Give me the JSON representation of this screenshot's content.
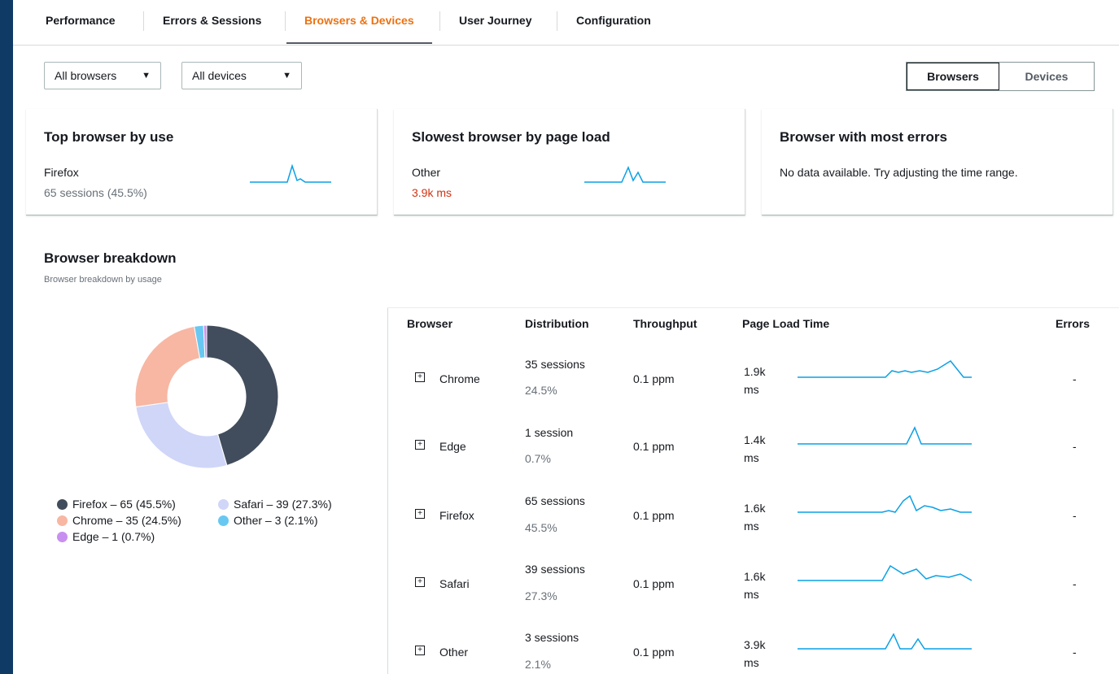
{
  "tabs": [
    "Performance",
    "Errors & Sessions",
    "Browsers & Devices",
    "User Journey",
    "Configuration"
  ],
  "active_tab_index": 2,
  "filters": {
    "browsers_select": "All browsers",
    "devices_select": "All devices"
  },
  "view_toggle": {
    "browsers": "Browsers",
    "devices": "Devices",
    "selected": "Browsers"
  },
  "cards": {
    "top_use": {
      "title": "Top browser by use",
      "name": "Firefox",
      "value": "65 sessions (45.5%)"
    },
    "slowest": {
      "title": "Slowest browser by page load",
      "name": "Other",
      "value": "3.9k ms"
    },
    "most_errors": {
      "title": "Browser with most errors",
      "message": "No data available. Try adjusting the time range."
    }
  },
  "breakdown": {
    "title": "Browser breakdown",
    "subtitle": "Browser breakdown by usage"
  },
  "chart_data": {
    "type": "pie",
    "slices": [
      {
        "label": "Firefox – 65 (45.5%)",
        "name": "Firefox",
        "value": 65,
        "color": "#414d5c"
      },
      {
        "label": "Safari – 39 (27.3%)",
        "name": "Safari",
        "value": 39,
        "color": "#cfd6f8"
      },
      {
        "label": "Chrome – 35 (24.5%)",
        "name": "Chrome",
        "value": 35,
        "color": "#f7b7a3"
      },
      {
        "label": "Other – 3 (2.1%)",
        "name": "Other",
        "value": 3,
        "color": "#68c8f2"
      },
      {
        "label": "Edge – 1 (0.7%)",
        "name": "Edge",
        "value": 1,
        "color": "#c790f0"
      }
    ]
  },
  "table": {
    "headers": [
      "Browser",
      "Distribution",
      "Throughput",
      "Page Load Time",
      "Errors"
    ],
    "rows": [
      {
        "browser": "Chrome",
        "sessions": "35 sessions",
        "pct": "24.5%",
        "throughput": "0.1 ppm",
        "load": "1.9k",
        "unit": "ms",
        "errors": "-"
      },
      {
        "browser": "Edge",
        "sessions": "1 session",
        "pct": "0.7%",
        "throughput": "0.1 ppm",
        "load": "1.4k",
        "unit": "ms",
        "errors": "-"
      },
      {
        "browser": "Firefox",
        "sessions": "65 sessions",
        "pct": "45.5%",
        "throughput": "0.1 ppm",
        "load": "1.6k",
        "unit": "ms",
        "errors": "-"
      },
      {
        "browser": "Safari",
        "sessions": "39 sessions",
        "pct": "27.3%",
        "throughput": "0.1 ppm",
        "load": "1.6k",
        "unit": "ms",
        "errors": "-"
      },
      {
        "browser": "Other",
        "sessions": "3 sessions",
        "pct": "2.1%",
        "throughput": "0.1 ppm",
        "load": "3.9k",
        "unit": "ms",
        "errors": "-"
      }
    ]
  },
  "colors": {
    "accent": "#ec7211",
    "sparkline": "#0aa0e6",
    "error_value": "#d13212"
  }
}
